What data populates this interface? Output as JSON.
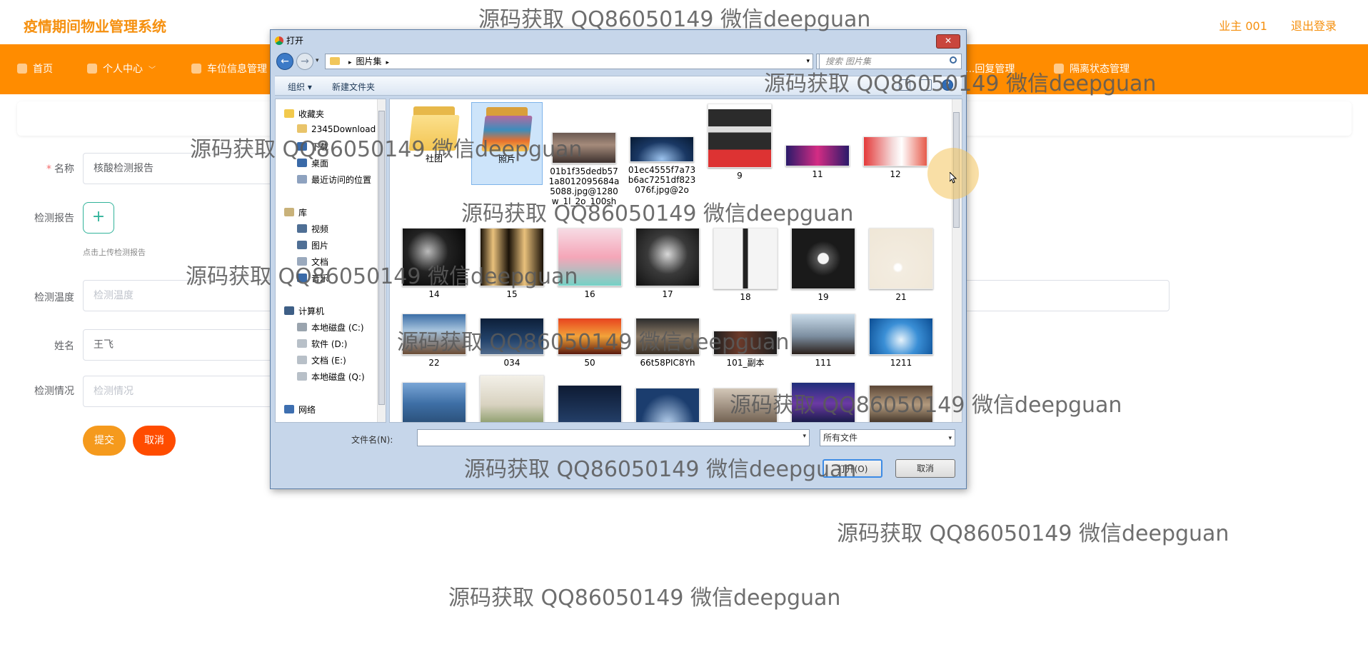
{
  "app": {
    "title": "疫情期间物业管理系统",
    "user_label": "业主 001",
    "logout_label": "退出登录"
  },
  "nav": {
    "items": [
      {
        "label": "首页",
        "icon": "home-icon"
      },
      {
        "label": "个人中心",
        "icon": "user-icon",
        "chevron": "﹀"
      },
      {
        "label": "车位信息管理",
        "icon": "car-icon"
      },
      {
        "label": "...回复管理",
        "icon": "reply-icon"
      },
      {
        "label": "隔离状态管理",
        "icon": "isolation-icon"
      }
    ]
  },
  "form": {
    "name_label": "名称",
    "name_value": "核酸检测报告",
    "report_label": "检测报告",
    "upload_plus": "+",
    "upload_hint": "点击上传检测报告",
    "temp_label": "检测温度",
    "temp_placeholder": "检测温度",
    "person_label": "姓名",
    "person_value": "王飞",
    "situation_label": "检测情况",
    "situation_placeholder": "检测情况",
    "submit_label": "提交",
    "cancel_label": "取消"
  },
  "dialog": {
    "title": "打开",
    "close_glyph": "✕",
    "breadcrumb": "图片集",
    "search_placeholder": "搜索 图片集",
    "toolbar": {
      "organize": "组织 ▾",
      "new_folder": "新建文件夹",
      "help": "?"
    },
    "nav_pane": {
      "favorites": "收藏夹",
      "fav_items": [
        "2345Download",
        "下载",
        "桌面",
        "最近访问的位置"
      ],
      "libraries": "库",
      "lib_items": [
        "视频",
        "图片",
        "文档",
        "音乐"
      ],
      "computer": "计算机",
      "drives": [
        "本地磁盘 (C:)",
        "软件 (D:)",
        "文档 (E:)",
        "本地磁盘 (Q:)"
      ],
      "network": "网络"
    },
    "files": [
      {
        "name": "社团",
        "kind": "folder"
      },
      {
        "name": "照片",
        "kind": "folder",
        "selected": true
      },
      {
        "name": "01b1f35dedb571a8012095684a5088.jpg@1280w_1l_2o_100sh",
        "kind": "image"
      },
      {
        "name": "01ec4555f7a73b6ac7251df823076f.jpg@2o",
        "kind": "image"
      },
      {
        "name": "9",
        "kind": "image"
      },
      {
        "name": "11",
        "kind": "image"
      },
      {
        "name": "12",
        "kind": "image"
      },
      {
        "name": "14",
        "kind": "image"
      },
      {
        "name": "15",
        "kind": "image"
      },
      {
        "name": "16",
        "kind": "image"
      },
      {
        "name": "17",
        "kind": "image"
      },
      {
        "name": "18",
        "kind": "image"
      },
      {
        "name": "19",
        "kind": "image"
      },
      {
        "name": "21",
        "kind": "image"
      },
      {
        "name": "22",
        "kind": "image"
      },
      {
        "name": "034",
        "kind": "image"
      },
      {
        "name": "50",
        "kind": "image"
      },
      {
        "name": "66t58PIC8Yh",
        "kind": "image"
      },
      {
        "name": "101_副本",
        "kind": "image"
      },
      {
        "name": "111",
        "kind": "image"
      },
      {
        "name": "1211",
        "kind": "image"
      }
    ],
    "filename_label": "文件名(N):",
    "filename_value": "",
    "filetype_value": "所有文件",
    "open_label": "打开(O)",
    "cancel_label": "取消"
  },
  "watermark": "源码获取 QQ86050149 微信deepguan",
  "colors": {
    "brand": "#f5900f",
    "nav_bg": "#ff8c00",
    "submit": "#f59a1d",
    "cancel": "#ff4c00",
    "upload_accent": "#31b39a"
  }
}
